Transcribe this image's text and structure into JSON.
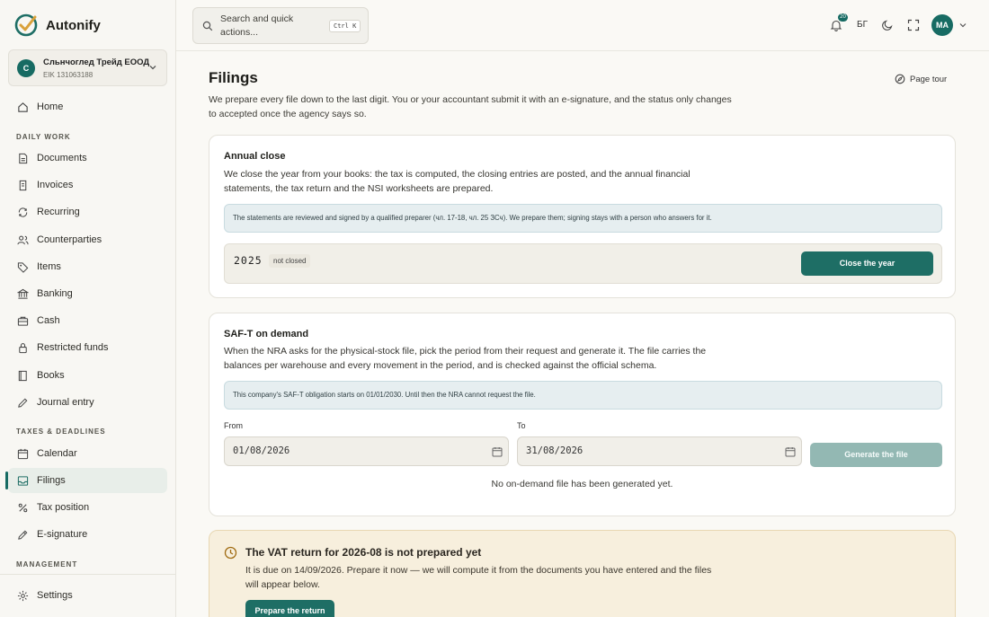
{
  "app": {
    "name": "Autonify"
  },
  "company": {
    "avatar": "С",
    "name": "Сльнчоглед Трейд ЕООД",
    "id": "EIK 131063188"
  },
  "search": {
    "placeholder": "Search and quick actions...",
    "shortcut": "Ctrl K"
  },
  "topbar": {
    "notifications_count": "20",
    "language": "БГ",
    "user_initials": "MA"
  },
  "sidebar": {
    "home": "Home",
    "section_daily": "DAILY WORK",
    "daily": [
      "Documents",
      "Invoices",
      "Recurring",
      "Counterparties",
      "Items",
      "Banking",
      "Cash",
      "Restricted funds",
      "Books",
      "Journal entry"
    ],
    "section_taxes": "TAXES & DEADLINES",
    "taxes": [
      "Calendar",
      "Filings",
      "Tax position",
      "E-signature"
    ],
    "section_management": "MANAGEMENT",
    "settings": "Settings"
  },
  "page": {
    "title": "Filings",
    "description": "We prepare every file down to the last digit. You or your accountant submit it with an e-signature, and the status only changes to accepted once the agency says so.",
    "tour": "Page tour"
  },
  "annual_close": {
    "title": "Annual close",
    "description": "We close the year from your books: the tax is computed, the closing entries are posted, and the annual financial statements, the tax return and the NSI worksheets are prepared.",
    "note": "The statements are reviewed and signed by a qualified preparer (чл. 17-18, чл. 25 ЗСч). We prepare them; signing stays with a person who answers for it.",
    "year": "2025",
    "status": "not closed",
    "button": "Close the year"
  },
  "saft": {
    "title": "SAF-T on demand",
    "description": "When the NRA asks for the physical-stock file, pick the period from their request and generate it. The file carries the balances per warehouse and every movement in the period, and is checked against the official schema.",
    "note": "This company's SAF-T obligation starts on 01/01/2030. Until then the NRA cannot request the file.",
    "from_label": "From",
    "from_value": "01/08/2026",
    "to_label": "To",
    "to_value": "31/08/2026",
    "button": "Generate the file",
    "empty": "No on-demand file has been generated yet."
  },
  "vat_alert": {
    "title": "The VAT return for 2026-08 is not prepared yet",
    "description": "It is due on 14/09/2026. Prepare it now — we will compute it from the documents you have entered and the files will appear below.",
    "button": "Prepare the return"
  },
  "colors": {
    "accent": "#1e6e65",
    "note_bg": "#e6eef0",
    "alert_bg": "#f7efdd"
  }
}
